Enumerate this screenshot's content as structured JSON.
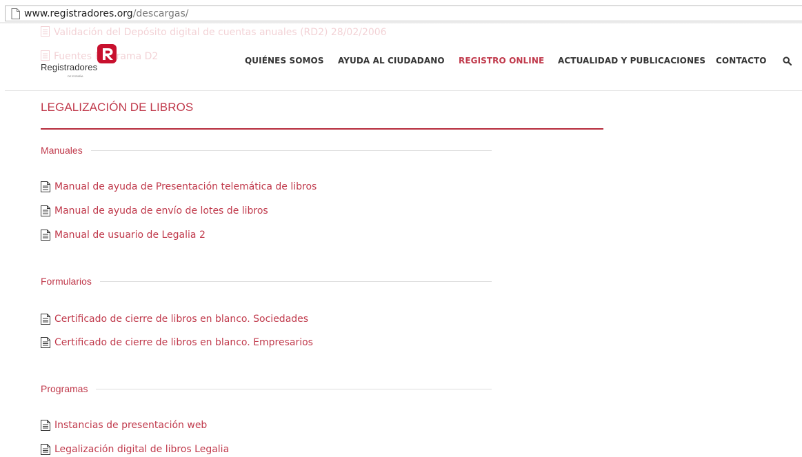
{
  "browser": {
    "url_domain": "www.registradores.org",
    "url_path": "/descargas/"
  },
  "ghost_links": [
    "Validación del Depósito digital de cuentas anuales (RD2) 28/02/2006",
    "Fuentes Programa D2"
  ],
  "logo": {
    "name": "Registradores",
    "sub": "DE ESPAÑA",
    "brand_color": "#c8102e"
  },
  "nav": {
    "items": [
      "QUIÉNES SOMOS",
      "AYUDA AL CIUDADANO",
      "REGISTRO ONLINE",
      "ACTUALIDAD Y PUBLICACIONES",
      "CONTACTO"
    ],
    "active_index": 2
  },
  "page": {
    "title": "LEGALIZACIÓN DE LIBROS"
  },
  "sections": [
    {
      "label": "Manuales",
      "links": [
        "Manual de ayuda de Presentación telemática de libros",
        "Manual de ayuda de envío de lotes de libros",
        "Manual de usuario de Legalia 2"
      ]
    },
    {
      "label": "Formularios",
      "links": [
        "Certificado de cierre de libros en blanco. Sociedades",
        "Certificado de cierre de libros en blanco. Empresarios"
      ]
    },
    {
      "label": "Programas",
      "links": [
        "Instancias de presentación web",
        "Legalización digital de libros Legalia"
      ]
    }
  ],
  "colors": {
    "accent": "#c0394b",
    "rule": "#b52a3a"
  }
}
